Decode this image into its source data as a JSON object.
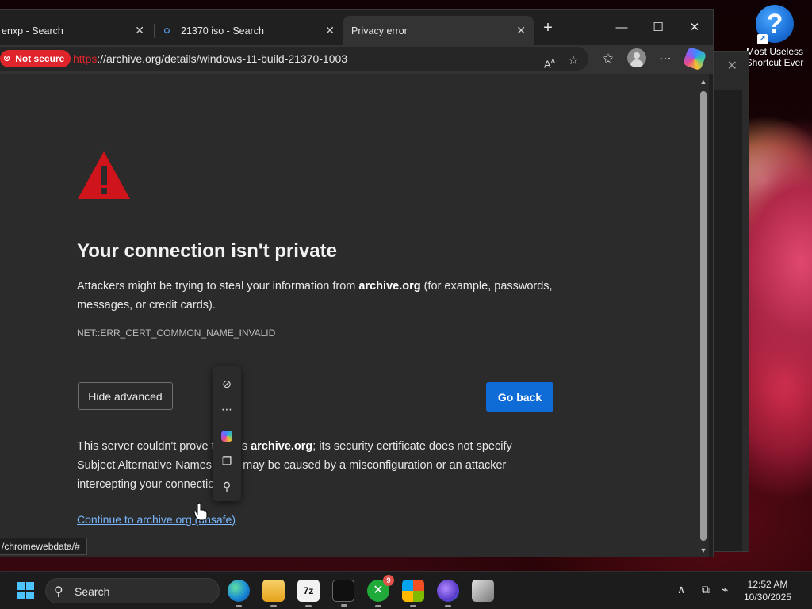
{
  "desktop": {
    "icon_label": "Most Useless Shortcut Ever"
  },
  "browser": {
    "tabs": [
      {
        "label": "enxp - Search"
      },
      {
        "label": "21370 iso - Search"
      },
      {
        "label": "Privacy error"
      }
    ],
    "security_badge": "Not secure",
    "url_protocol": "https",
    "url_rest": "://archive.org/details/windows-11-build-21370-1003",
    "status_bar_url": "/chromewebdata/#"
  },
  "error_page": {
    "heading": "Your connection isn't private",
    "para_before": "Attackers might be trying to steal your information from ",
    "para_host": "archive.org",
    "para_after": " (for example, passwords, messages, or credit cards).",
    "error_code": "NET::ERR_CERT_COMMON_NAME_INVALID",
    "hide_advanced_label": "Hide advanced",
    "go_back_label": "Go back",
    "adv_before": "This server couldn't prove that it's ",
    "adv_host": "archive.org",
    "adv_after": "; its security certificate does not specify Subject Alternative Names. This may be caused by a misconfiguration or an attacker intercepting your connection.",
    "continue_link": "Continue to archive.org (unsafe)"
  },
  "taskbar": {
    "search_label": "Search",
    "xbox_badge": "9",
    "time": "12:52 AM",
    "date": "10/30/2025"
  },
  "colors": {
    "accent": "#0f6cd6",
    "danger": "#e0242c",
    "link": "#7ab7ff"
  }
}
